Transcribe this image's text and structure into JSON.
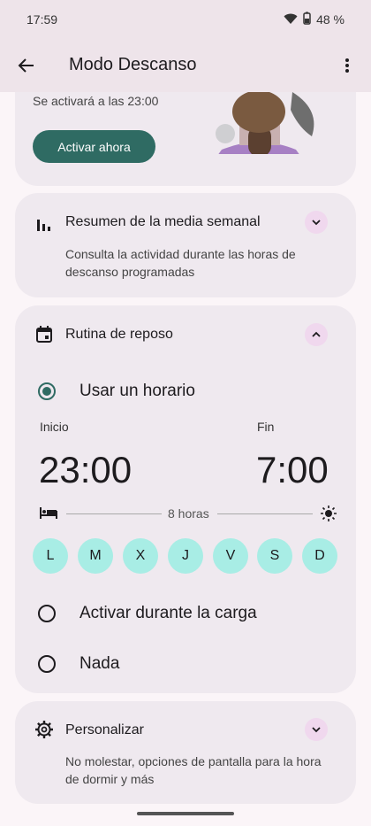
{
  "status": {
    "time": "17:59",
    "battery": "48 %"
  },
  "app_bar": {
    "title": "Modo Descanso"
  },
  "top_card": {
    "schedule_text": "Se activará a las 23:00",
    "activate_label": "Activar ahora"
  },
  "summary_card": {
    "title": "Resumen de la media semanal",
    "description": "Consulta la actividad durante las horas de descanso programadas"
  },
  "routine_card": {
    "title": "Rutina de reposo",
    "use_schedule_label": "Usar un horario",
    "start_label": "Inicio",
    "end_label": "Fin",
    "start_time": "23:00",
    "end_time": "7:00",
    "duration": "8 horas",
    "days": [
      "L",
      "M",
      "X",
      "J",
      "V",
      "S",
      "D"
    ],
    "charging_label": "Activar durante la carga",
    "none_label": "Nada"
  },
  "custom_card": {
    "title": "Personalizar",
    "description": "No molestar, opciones de pantalla para la hora de dormir y más"
  },
  "colors": {
    "accent": "#2f6b63",
    "day_chip": "#a8ede5",
    "app_bar": "#eee4ea",
    "card": "#efe9ef"
  }
}
